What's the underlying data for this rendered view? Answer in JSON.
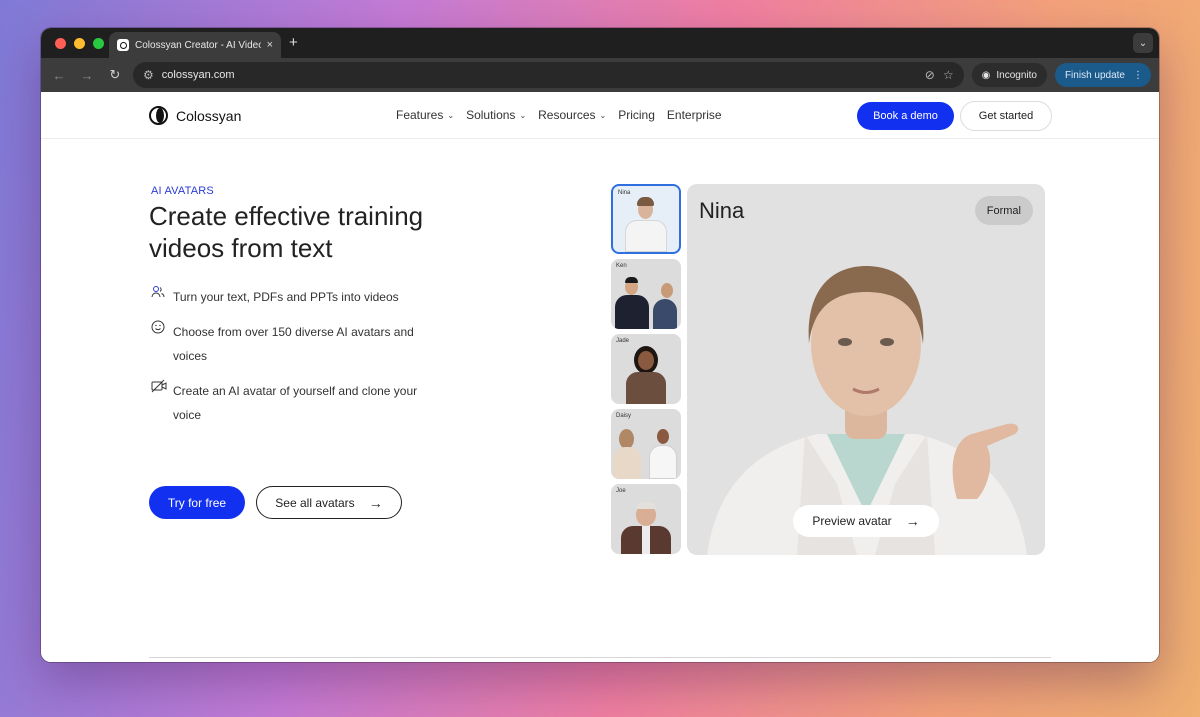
{
  "browser": {
    "tab_title": "Colossyan Creator - AI Video",
    "tab_close": "×",
    "new_tab": "+",
    "url": "colossyan.com",
    "incognito_label": "Incognito",
    "finish_update_label": "Finish update"
  },
  "nav": {
    "logo_text": "Colossyan",
    "menu": [
      {
        "label": "Features",
        "has_dropdown": true
      },
      {
        "label": "Solutions",
        "has_dropdown": true
      },
      {
        "label": "Resources",
        "has_dropdown": true
      },
      {
        "label": "Pricing",
        "has_dropdown": false
      },
      {
        "label": "Enterprise",
        "has_dropdown": false
      }
    ],
    "book_demo": "Book a demo",
    "get_started": "Get started"
  },
  "hero": {
    "eyebrow": "AI AVATARS",
    "headline": "Create effective training videos from text",
    "features": [
      {
        "icon": "users-icon",
        "text": "Turn your text, PDFs and PPTs into videos"
      },
      {
        "icon": "smiley-icon",
        "text": "Choose from over 150 diverse AI avatars and voices"
      },
      {
        "icon": "camera-off-icon",
        "text": "Create an AI avatar of yourself and clone your voice"
      }
    ],
    "try_free": "Try for free",
    "see_all": "See all avatars"
  },
  "avatars": {
    "thumbnails": [
      "Nina",
      "Ken",
      "Jade",
      "Daisy",
      "Joe"
    ],
    "selected_name": "Nina",
    "selected_style": "Formal",
    "preview_label": "Preview avatar"
  },
  "colors": {
    "accent": "#1230ef",
    "eyebrow": "#2a3bd8",
    "selection": "#2f6fe0"
  }
}
